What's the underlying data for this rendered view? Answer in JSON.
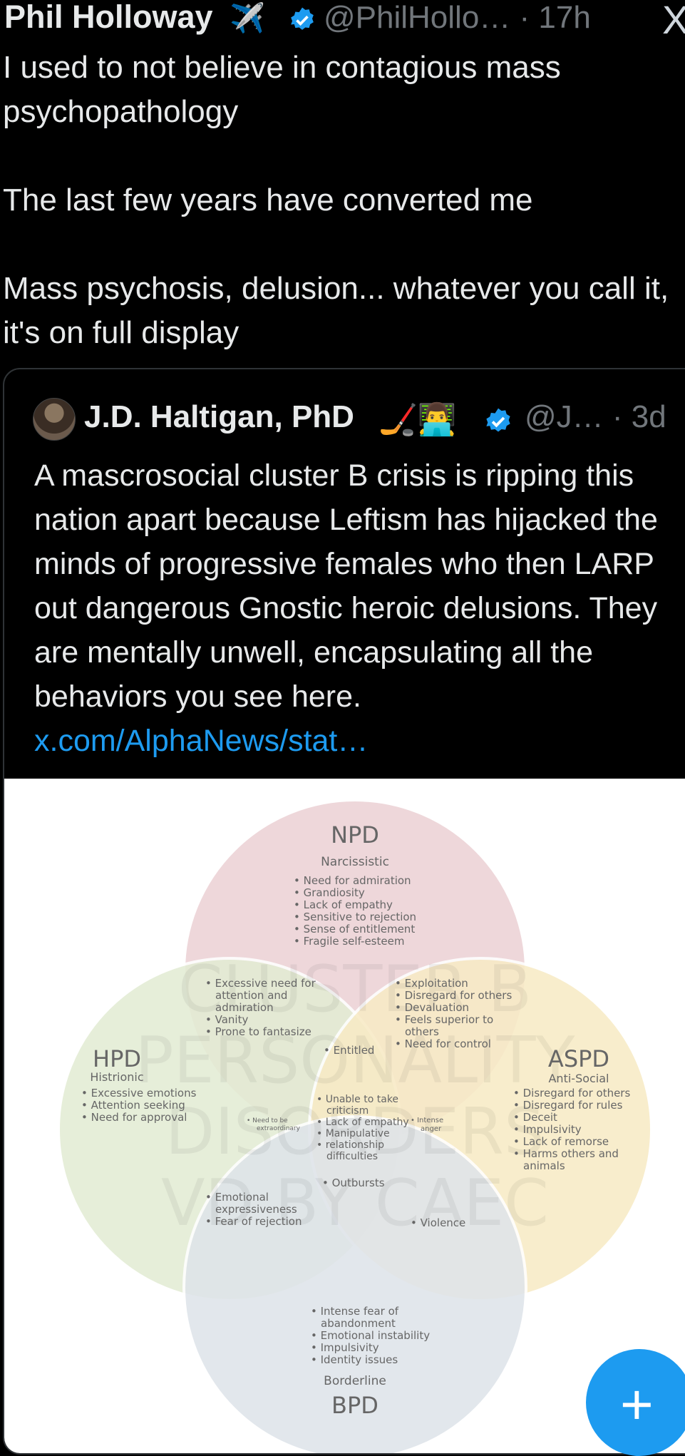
{
  "tweet": {
    "author_name": "Phil Holloway",
    "author_emoji": "✈️",
    "handle_time": "@PhilHollo… · 17h",
    "paragraphs": [
      "I used to not believe in contagious mass psychopathology",
      "The last few years have converted me",
      "Mass psychosis, delusion... whatever you call it, it's on full display"
    ],
    "close_glyph": "X"
  },
  "quote": {
    "author_name": "J.D. Haltigan, PhD",
    "author_emoji": "🏒👨‍💻",
    "handle_time": "@J… · 3d",
    "text": "A mascrosocial cluster B crisis is ripping this nation apart because Leftism has hijacked the minds of progressive females who then LARP out dangerous Gnostic heroic delusions. They are mentally unwell, encapsulating all the behaviors you see here. ",
    "link": "x.com/AlphaNews/stat…"
  },
  "venn": {
    "watermark": [
      "CLUSTER B",
      "PERSONALITY",
      "DISORDERS",
      "VD BY CAEC"
    ],
    "npd": {
      "code": "NPD",
      "name": "Narcissistic",
      "traits": [
        "Need for admiration",
        "Grandiosity",
        "Lack of empathy",
        "Sensitive to rejection",
        "Sense of entitlement",
        "Fragile self-esteem"
      ]
    },
    "hpd": {
      "code": "HPD",
      "name": "Histrionic",
      "traits": [
        "Excessive emotions",
        "Attention seeking",
        "Need for approval"
      ]
    },
    "aspd": {
      "code": "ASPD",
      "name": "Anti-Social",
      "traits": [
        "Disregard for others",
        "Disregard for rules",
        "Deceit",
        "Impulsivity",
        "Lack of remorse",
        "Harms others and",
        "animals"
      ]
    },
    "bpd": {
      "code": "BPD",
      "name": "Borderline",
      "traits": [
        "Intense fear of",
        "abandonment",
        "Emotional instability",
        "Impulsivity",
        "Identity issues"
      ]
    },
    "npd_hpd": [
      "Excessive need for",
      "attention and",
      "admiration",
      "Vanity",
      "Prone to fantasize"
    ],
    "npd_aspd": [
      "Exploitation",
      "Disregard for others",
      "Devaluation",
      "Feels superior to",
      "others",
      "Need for control"
    ],
    "entitled": "Entitled",
    "center": [
      "Unable to take",
      "criticism",
      "Lack of empathy",
      "Manipulative",
      "relationship",
      "difficulties"
    ],
    "need_extraordinary": [
      "Need to be",
      "extraordinary"
    ],
    "intense_anger": [
      "Intense",
      "anger"
    ],
    "outbursts": "Outbursts",
    "hpd_bpd": [
      "Emotional",
      "expressiveness",
      "Fear of rejection"
    ],
    "violence": "Violence"
  },
  "fab": {
    "glyph": "+"
  },
  "colors": {
    "npd": "#ecd2d6",
    "hpd": "#e3ecd4",
    "aspd": "#f8ebc6",
    "bpd": "#dfe4ea",
    "link": "#1d9bf0",
    "fab": "#1d9bf0"
  }
}
